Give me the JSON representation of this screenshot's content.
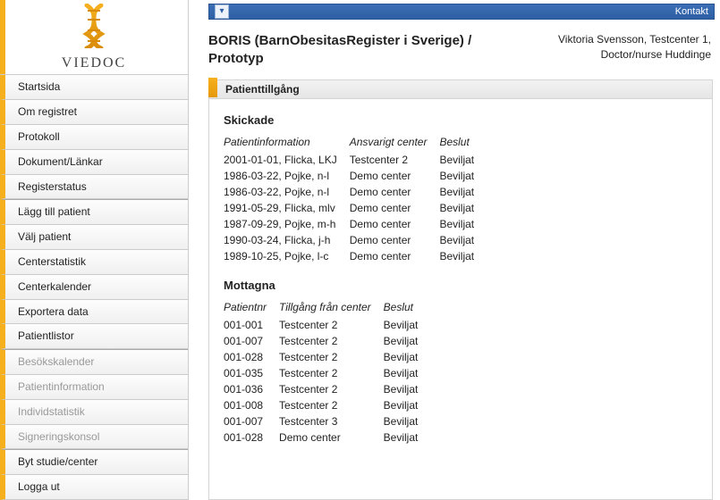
{
  "brand": {
    "name": "VIEDOC"
  },
  "topbar": {
    "contact": "Kontakt"
  },
  "header": {
    "title": "BORIS (BarnObesitasRegister i Sverige) / Prototyp",
    "user_line1": "Viktoria Svensson, Testcenter 1,",
    "user_line2": "Doctor/nurse Huddinge"
  },
  "section": {
    "title": "Patienttillgång"
  },
  "sidebar": {
    "group1": [
      {
        "label": "Startsida"
      },
      {
        "label": "Om registret"
      },
      {
        "label": "Protokoll"
      },
      {
        "label": "Dokument/Länkar"
      },
      {
        "label": "Registerstatus"
      }
    ],
    "group2": [
      {
        "label": "Lägg till patient"
      },
      {
        "label": "Välj patient"
      },
      {
        "label": "Centerstatistik"
      },
      {
        "label": "Centerkalender"
      },
      {
        "label": "Exportera data"
      },
      {
        "label": "Patientlistor"
      }
    ],
    "group3": [
      {
        "label": "Besökskalender",
        "disabled": true
      },
      {
        "label": "Patientinformation",
        "disabled": true
      },
      {
        "label": "Individstatistik",
        "disabled": true
      },
      {
        "label": "Signeringskonsol",
        "disabled": true
      }
    ],
    "group4": [
      {
        "label": "Byt studie/center"
      },
      {
        "label": "Logga ut"
      }
    ]
  },
  "sent": {
    "heading": "Skickade",
    "columns": [
      "Patientinformation",
      "Ansvarigt center",
      "Beslut"
    ],
    "rows": [
      {
        "info": "2001-01-01, Flicka, LKJ",
        "center": "Testcenter 2",
        "decision": "Beviljat"
      },
      {
        "info": "1986-03-22, Pojke, n-l",
        "center": "Demo center",
        "decision": "Beviljat"
      },
      {
        "info": "1986-03-22, Pojke, n-l",
        "center": "Demo center",
        "decision": "Beviljat"
      },
      {
        "info": "1991-05-29, Flicka, mlv",
        "center": "Demo center",
        "decision": "Beviljat"
      },
      {
        "info": "1987-09-29, Pojke, m-h",
        "center": "Demo center",
        "decision": "Beviljat"
      },
      {
        "info": "1990-03-24, Flicka, j-h",
        "center": "Demo center",
        "decision": "Beviljat"
      },
      {
        "info": "1989-10-25, Pojke, l-c",
        "center": "Demo center",
        "decision": "Beviljat"
      }
    ]
  },
  "received": {
    "heading": "Mottagna",
    "columns": [
      "Patientnr",
      "Tillgång från center",
      "Beslut"
    ],
    "rows": [
      {
        "nr": "001-001",
        "center": "Testcenter 2",
        "decision": "Beviljat"
      },
      {
        "nr": "001-007",
        "center": "Testcenter 2",
        "decision": "Beviljat"
      },
      {
        "nr": "001-028",
        "center": "Testcenter 2",
        "decision": "Beviljat"
      },
      {
        "nr": "001-035",
        "center": "Testcenter 2",
        "decision": "Beviljat"
      },
      {
        "nr": "001-036",
        "center": "Testcenter 2",
        "decision": "Beviljat"
      },
      {
        "nr": "001-008",
        "center": "Testcenter 2",
        "decision": "Beviljat"
      },
      {
        "nr": "001-007",
        "center": "Testcenter 3",
        "decision": "Beviljat"
      },
      {
        "nr": "001-028",
        "center": "Demo center",
        "decision": "Beviljat"
      }
    ]
  }
}
